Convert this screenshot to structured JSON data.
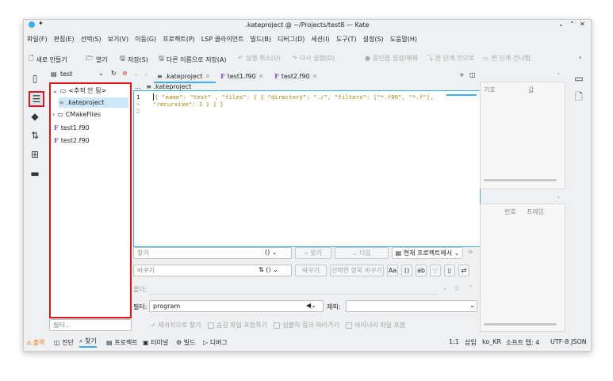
{
  "titlebar": {
    "title": ".kateproject @ ~/Projects/test8 — Kate"
  },
  "menu": [
    "파일(F)",
    "편집(E)",
    "선택(S)",
    "보기(V)",
    "이동(G)",
    "프로젝트(P)",
    "LSP 클라이언트",
    "빌드(B)",
    "디버그(D)",
    "세션(I)",
    "도구(T)",
    "설정(S)",
    "도움말(H)"
  ],
  "toolbar": {
    "new": "새로 만들기",
    "open": "열기",
    "save": "저장(S)",
    "save_as": "다른 이름으로 저장(A)",
    "undo": "실행 취소(U)",
    "redo": "다시 실행(D)",
    "breakpoint": "중단점 설정/해제",
    "step_into": "한 단계 안으로",
    "step_over": "한 단계 건너뜀"
  },
  "project": {
    "name": "test"
  },
  "tree": {
    "root": "<추적 안 됨>",
    "items": [
      ".kateproject",
      "CMakeFiles",
      "test1.f90",
      "test2.f90"
    ],
    "filter_placeholder": "필터..."
  },
  "tabs": [
    ".kateproject",
    "test1.f90",
    "test2.f90"
  ],
  "breadcrumb": {
    "dots": "...",
    "file": ".kateproject"
  },
  "editor": {
    "line_numbers": [
      "1",
      "",
      "2"
    ],
    "line1": "{ \"name\": \"test\" , \"files\": [ { \"directory\": \"./\", \"filters\": [\"*.f90\", \"*.f\"],",
    "line1b": "\"recursive\": 1 } ] }"
  },
  "right_panel": {
    "col1": "기호",
    "col2": "값",
    "col3": "번호",
    "col4": "프레임"
  },
  "search": {
    "find_placeholder": "찾기",
    "find_btn": "찾기",
    "next_btn": "다음",
    "scope": "현재 프로젝트에서",
    "replace_placeholder": "바꾸기",
    "replace_btn": "바꾸기",
    "replace_checked_btn": "선택한 항목 바꾸기",
    "folder_label": "폴더:",
    "filter_label": "필터:",
    "filter_value": "program",
    "exclude_label": "제외:",
    "options": [
      "재귀적으로 찾기",
      "숨김 파일 포함하기",
      "심볼릭 링크 따라가기",
      "바이너리 파일 포함"
    ]
  },
  "statusbar": {
    "tabs": [
      "출력",
      "진단",
      "찾기",
      "프로젝트",
      "터미널",
      "빌드",
      "디버그"
    ],
    "position": "1:1",
    "mode": "삽입",
    "lang": "ko_KR",
    "indent": "소프트 탭: 4",
    "encoding": "UTF-8",
    "filetype": "JSON"
  },
  "colors": {
    "accent": "#3daee9",
    "highlight_red": "#e0141c",
    "bg": "#eff0f1"
  }
}
